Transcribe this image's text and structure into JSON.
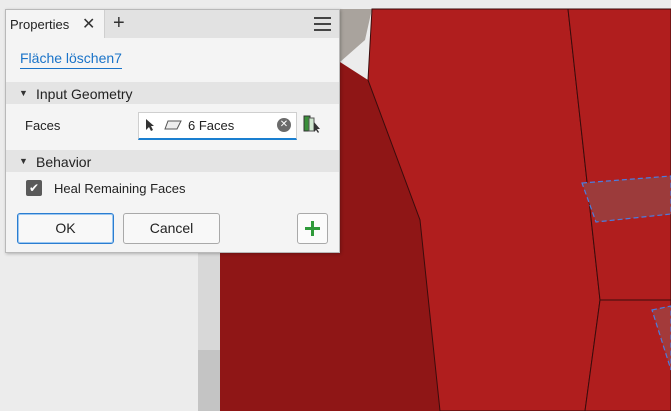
{
  "panel": {
    "tab_title": "Properties",
    "tab_close_glyph": "✕",
    "tab_add_glyph": "+",
    "menu_icon": "hamburger-menu-icon",
    "feature_name": "Fläche löschen7",
    "sections": {
      "input_geometry": {
        "title": "Input Geometry",
        "arrow": "▼"
      },
      "behavior": {
        "title": "Behavior",
        "arrow": "▼"
      }
    },
    "faces": {
      "label": "Faces",
      "value": "6 Faces",
      "cursor_icon": "select-cursor-icon",
      "face_icon": "face-icon",
      "clear_icon": "clear-icon",
      "clear_glyph": "✕",
      "chain_icon": "chain-faces-icon"
    },
    "heal": {
      "label": "Heal Remaining Faces",
      "checked": true,
      "check_glyph": "✔"
    },
    "buttons": {
      "ok": "OK",
      "cancel": "Cancel",
      "apply_icon": "plus-icon"
    }
  },
  "colors": {
    "model_red": "#b01e1e",
    "model_dark_red": "#8e1414",
    "accent_blue": "#1a73c8",
    "apply_green": "#2f9a3a"
  }
}
